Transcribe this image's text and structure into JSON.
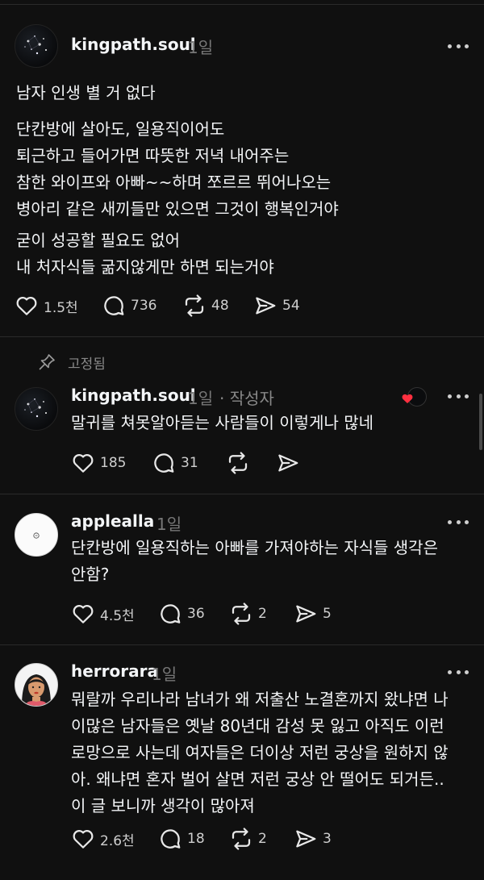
{
  "post": {
    "username": "kingpath.soul",
    "time": "1일",
    "paragraphs": [
      [
        "남자 인생 별 거 없다"
      ],
      [
        "단칸방에 살아도, 일용직이어도",
        "퇴근하고 들어가면 따뜻한 저녁 내어주는",
        "참한 와이프와 아빠~~하며 쪼르르 뛰어나오는",
        "병아리 같은 새끼들만 있으면 그것이 행복인거야"
      ],
      [
        "굳이 성공할 필요도 없어",
        "내 처자식들 굶지않게만 하면 되는거야"
      ]
    ],
    "stats": {
      "likes": "1.5천",
      "comments": "736",
      "reposts": "48",
      "shares": "54"
    }
  },
  "pinned": {
    "label": "고정됨"
  },
  "replies": [
    {
      "username": "kingpath.soul",
      "time": "1일",
      "author_tag": "· 작성자",
      "lines": [
        "말귀를 쳐못알아듣는 사람들이 이렇게나 많네"
      ],
      "stats": {
        "likes": "185",
        "comments": "31"
      }
    },
    {
      "username": "applealla",
      "time": "1일",
      "lines": [
        "단칸방에 일용직하는 아빠를 가져야하는 자식들 생각은",
        "안함?"
      ],
      "stats": {
        "likes": "4.5천",
        "comments": "36",
        "reposts": "2",
        "shares": "5"
      }
    },
    {
      "username": "herrorara",
      "time": "1일",
      "lines": [
        "뭐랄까 우리나라 남녀가 왜 저출산 노결혼까지 왔냐면 나",
        "이많은 남자들은 옛날 80년대 감성 못 잃고 아직도 이런",
        "로망으로 사는데 여자들은 더이상 저런 궁상을 원하지 않",
        "아. 왜냐면 혼자 벌어 살면 저런 궁상 안 떨어도 되거든..",
        "이 글 보니까 생각이 많아져"
      ],
      "stats": {
        "likes": "2.6천",
        "comments": "18",
        "reposts": "2",
        "shares": "3"
      }
    }
  ],
  "colors": {
    "background": "#101010",
    "text": "#f3f5f7",
    "muted": "#777777",
    "liked_heart": "#ff3040"
  },
  "icons": [
    "heart-icon",
    "comment-icon",
    "repost-icon",
    "share-icon",
    "more-icon",
    "pin-icon"
  ]
}
